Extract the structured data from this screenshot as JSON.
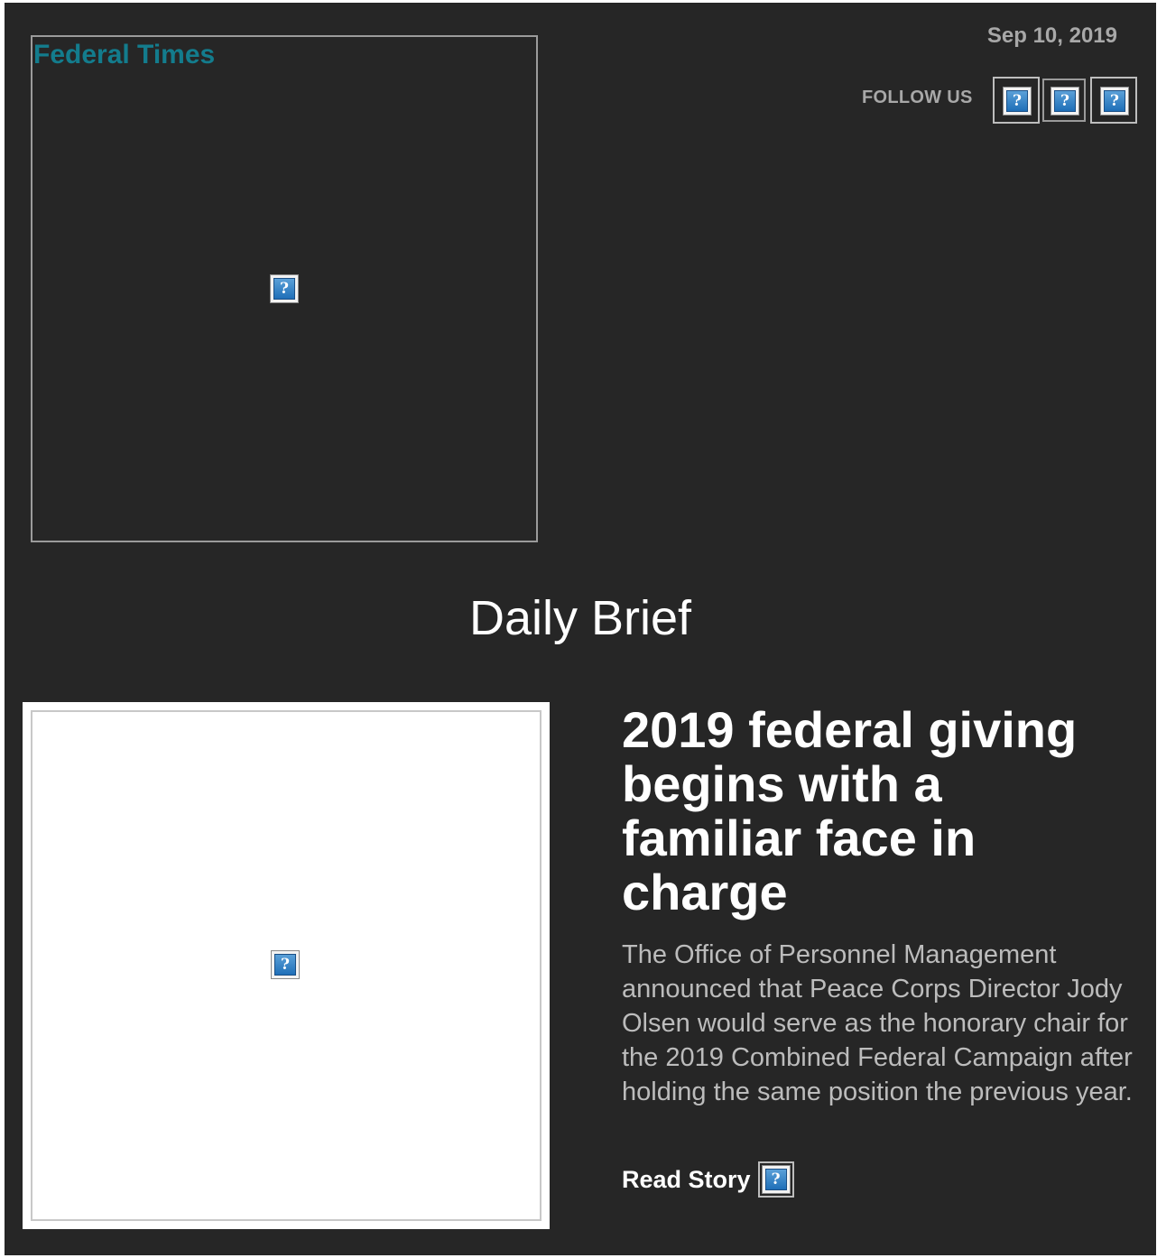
{
  "header": {
    "logo_alt": "Federal Times",
    "date": "Sep 10, 2019",
    "follow_label": "FOLLOW US",
    "social_icons": [
      "broken-image-icon",
      "broken-image-icon",
      "broken-image-icon"
    ]
  },
  "section": {
    "title": "Daily Brief"
  },
  "story": {
    "headline": "2019 federal giving begins with a familiar face in charge",
    "summary": "The Office of Personnel Management announced that Peace Corps Director Jody Olsen would serve as the honorary chair for the 2019 Combined Federal Campaign after holding the same position the previous year.",
    "read_label": "Read Story",
    "image_icon": "broken-image-icon"
  },
  "colors": {
    "background": "#262626",
    "logo_text": "#137c8d",
    "muted_text": "#a8a8a8",
    "headline": "#ffffff"
  }
}
